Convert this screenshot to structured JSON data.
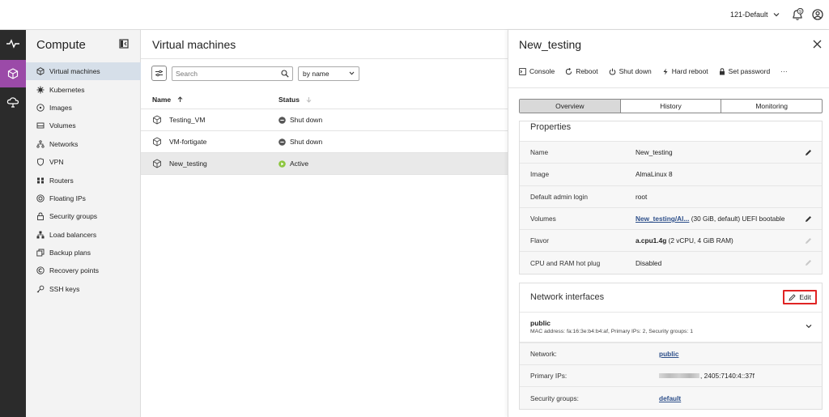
{
  "topbar": {
    "project": "121-Default",
    "notification_count": "9"
  },
  "rail": {
    "items": [
      "activity",
      "compute",
      "cloud"
    ]
  },
  "sidenav": {
    "title": "Compute",
    "items": [
      {
        "label": "Virtual machines",
        "icon": "cube-icon"
      },
      {
        "label": "Kubernetes",
        "icon": "helm-icon"
      },
      {
        "label": "Images",
        "icon": "disc-icon"
      },
      {
        "label": "Volumes",
        "icon": "drive-icon"
      },
      {
        "label": "Networks",
        "icon": "network-icon"
      },
      {
        "label": "VPN",
        "icon": "shield-icon"
      },
      {
        "label": "Routers",
        "icon": "router-icon"
      },
      {
        "label": "Floating IPs",
        "icon": "floating-ip-icon"
      },
      {
        "label": "Security groups",
        "icon": "lock-icon"
      },
      {
        "label": "Load balancers",
        "icon": "load-balancer-icon"
      },
      {
        "label": "Backup plans",
        "icon": "backup-icon"
      },
      {
        "label": "Recovery points",
        "icon": "recovery-icon"
      },
      {
        "label": "SSH keys",
        "icon": "key-icon"
      }
    ]
  },
  "list": {
    "title": "Virtual machines",
    "search_placeholder": "Search",
    "sort_value": "by name",
    "col_name": "Name",
    "col_status": "Status",
    "rows": [
      {
        "name": "Testing_VM",
        "status": "Shut down"
      },
      {
        "name": "VM-fortigate",
        "status": "Shut down"
      },
      {
        "name": "New_testing",
        "status": "Active"
      }
    ]
  },
  "detail": {
    "title": "New_testing",
    "actions": [
      "Console",
      "Reboot",
      "Shut down",
      "Hard reboot",
      "Set password"
    ],
    "more": "···",
    "tabs": [
      "Overview",
      "History",
      "Monitoring"
    ],
    "properties_title": "Properties",
    "properties": [
      {
        "label": "Name",
        "value": "New_testing"
      },
      {
        "label": "Image",
        "value": "AlmaLinux 8"
      },
      {
        "label": "Default admin login",
        "value": "root"
      },
      {
        "label": "Volumes",
        "link": "New_testing/Al...",
        "rest": " (30 GiB, default) UEFI bootable"
      },
      {
        "label": "Flavor",
        "bold": "a.cpu1.4g",
        "rest": " (2 vCPU, 4 GiB RAM)"
      },
      {
        "label": "CPU and RAM hot plug",
        "value": "Disabled"
      }
    ],
    "network": {
      "title": "Network interfaces",
      "edit_label": "Edit",
      "iface_name": "public",
      "iface_meta": "MAC address: fa:16:3e:b4:b4:af, Primary IPs: 2, Security groups: 1",
      "network_label": "Network:",
      "network_value": "public",
      "ips_label": "Primary IPs:",
      "ips_value": ", 2405:7140:4::37f",
      "sg_label": "Security groups:",
      "sg_value": "default"
    }
  },
  "colors": {
    "accent": "#9b4aa8",
    "active_status": "#8cc63f",
    "selected_nav": "#d6dfe9",
    "edit_highlight": "#e02424"
  }
}
